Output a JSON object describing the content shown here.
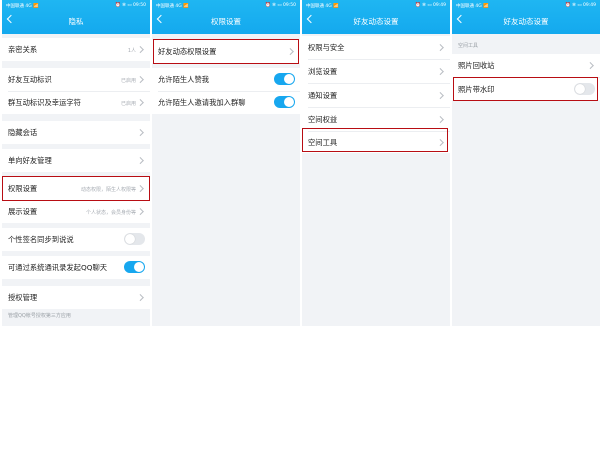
{
  "status_bar": {
    "carrier": "中国联通 4G 📶",
    "time_1": "⏰ ✻ ▭ 09:50",
    "time_2": "⏰ ✻ ▭ 09:50",
    "time_3": "⏰ ✻ ▭ 09:49",
    "time_4": "⏰ ✻ ▭ 09:49"
  },
  "colors": {
    "header": "#14a9ee",
    "toggle_on": "#17a7ef",
    "highlight": "#b80d13",
    "background": "#f1f3f6"
  },
  "screen1": {
    "title": "隐私",
    "back_icon": "chevron-left-icon",
    "items": [
      {
        "label": "亲密关系",
        "value": "1人"
      },
      {
        "label": "好友互动标识",
        "value": "已启用"
      },
      {
        "label": "群互动标识及幸运字符",
        "value": "已启用"
      },
      {
        "label": "隐藏会话",
        "value": ""
      },
      {
        "label": "单向好友管理",
        "value": ""
      },
      {
        "label": "权限设置",
        "value": "动态权限，陌生人权限等"
      },
      {
        "label": "展示设置",
        "value": "个人状态，会员身份等"
      },
      {
        "label": "个性签名同步到说说",
        "toggle": "off"
      },
      {
        "label": "可通过系统通讯录发起QQ聊天",
        "toggle": "on"
      },
      {
        "label": "授权管理",
        "value": ""
      }
    ],
    "footer": "管理QQ帐号授权第三方应用"
  },
  "screen2": {
    "title": "权限设置",
    "items": [
      {
        "label": "好友动态权限设置"
      },
      {
        "label": "允许陌生人赞我",
        "toggle": "on"
      },
      {
        "label": "允许陌生人邀请我加入群聊",
        "toggle": "on"
      }
    ]
  },
  "screen3": {
    "title": "好友动态设置",
    "items": [
      {
        "label": "权限与安全"
      },
      {
        "label": "浏览设置"
      },
      {
        "label": "通知设置"
      },
      {
        "label": "空间权益"
      },
      {
        "label": "空间工具"
      }
    ]
  },
  "screen4": {
    "title": "好友动态设置",
    "section": "空间工具",
    "items": [
      {
        "label": "照片回收站"
      },
      {
        "label": "照片带水印",
        "toggle": "off"
      }
    ]
  }
}
